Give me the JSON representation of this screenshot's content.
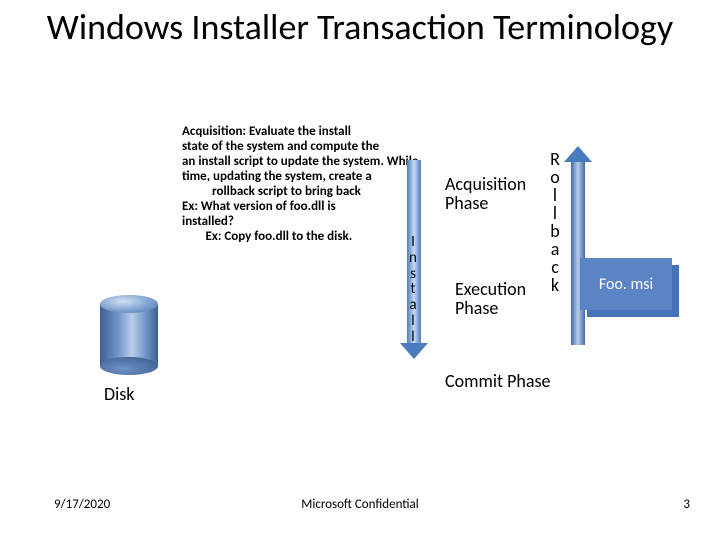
{
  "title": "Windows Installer Transaction Terminology",
  "overlay": {
    "l1": "Acquisition: Evaluate the install",
    "l2": "state of the system and compute the",
    "l3": "an install script to update the system. While",
    "l4": "time, updating the system, create a",
    "l5": "rollback script to bring back",
    "l6": "Ex: What version of foo.dll is",
    "l7": "installed?",
    "l8_prefix": "        ",
    "l8": "Ex: Copy foo.dll to the disk."
  },
  "vertical": {
    "install": "Install",
    "rollback": "Rollback"
  },
  "phases": {
    "acq1": "Acquisition",
    "acq2": "Phase",
    "exec1": "Execution",
    "exec2": "Phase",
    "commit": "Commit Phase"
  },
  "msi": {
    "label": "Foo. msi"
  },
  "disk": {
    "label": "Disk"
  },
  "footer": {
    "date": "9/17/2020",
    "center": "Microsoft Confidential",
    "page": "3"
  }
}
